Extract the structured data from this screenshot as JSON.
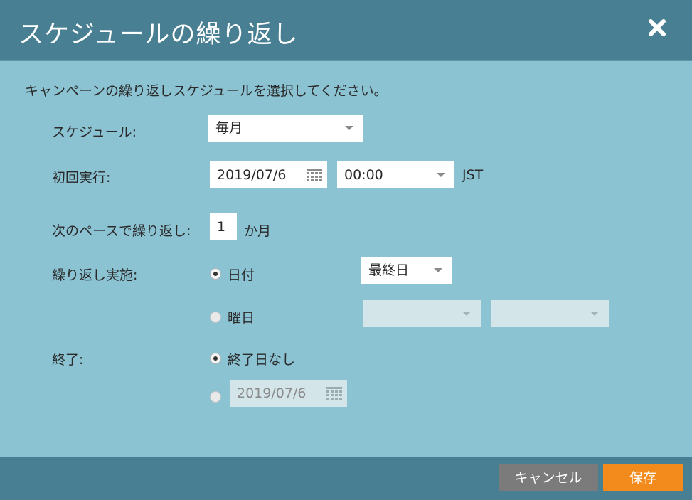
{
  "dialog": {
    "title": "スケジュールの繰り返し",
    "close_icon": "close-icon",
    "instructions": "キャンペーンの繰り返しスケジュールを選択してください。"
  },
  "schedule": {
    "label": "スケジュール:",
    "value": "毎月"
  },
  "first_run": {
    "label": "初回実行:",
    "date": "2019/07/6",
    "time": "00:00",
    "timezone": "JST"
  },
  "repeat_every": {
    "label": "次のペースで繰り返し:",
    "value": "1",
    "unit": "か月"
  },
  "repeat_on": {
    "label": "繰り返し実施:",
    "date_option": "日付",
    "date_value": "最終日",
    "weekday_option": "曜日",
    "weekday_value_1": "",
    "weekday_value_2": ""
  },
  "end": {
    "label": "終了:",
    "no_end_option": "終了日なし",
    "end_date": "2019/07/6"
  },
  "footer": {
    "cancel_label": "キャンセル",
    "save_label": "保存"
  },
  "colors": {
    "header": "#487f93",
    "body": "#8bc3d3",
    "save_button": "#f28a1c",
    "cancel_button": "#7b7b7b"
  }
}
